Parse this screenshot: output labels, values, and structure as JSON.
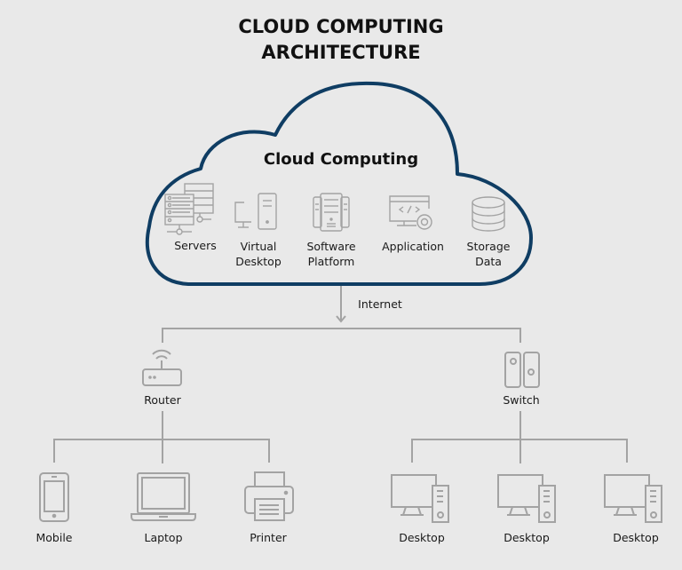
{
  "title": {
    "line1": "CLOUD COMPUTING",
    "line2": "ARCHITECTURE"
  },
  "colors": {
    "background": "#e9e9e9",
    "cloud_outline": "#0f3d63",
    "icon_stroke": "#a3a3a3",
    "connector": "#a3a3a3",
    "text": "#111111"
  },
  "cloud": {
    "title": "Cloud Computing",
    "services": [
      {
        "icon": "servers-icon",
        "line1": "Servers",
        "line2": ""
      },
      {
        "icon": "virtual-desktop-icon",
        "line1": "Virtual",
        "line2": "Desktop"
      },
      {
        "icon": "software-platform-icon",
        "line1": "Software",
        "line2": "Platform"
      },
      {
        "icon": "application-icon",
        "line1": "Application",
        "line2": ""
      },
      {
        "icon": "storage-data-icon",
        "line1": "Storage",
        "line2": "Data"
      }
    ]
  },
  "connection": {
    "label": "Internet",
    "arrow_icon": "arrow-down-icon"
  },
  "network": {
    "router": {
      "label": "Router",
      "icon": "router-icon",
      "devices": [
        {
          "label": "Mobile",
          "icon": "mobile-icon"
        },
        {
          "label": "Laptop",
          "icon": "laptop-icon"
        },
        {
          "label": "Printer",
          "icon": "printer-icon"
        }
      ]
    },
    "switch": {
      "label": "Switch",
      "icon": "switch-icon",
      "devices": [
        {
          "label": "Desktop",
          "icon": "desktop-icon"
        },
        {
          "label": "Desktop",
          "icon": "desktop-icon"
        },
        {
          "label": "Desktop",
          "icon": "desktop-icon"
        }
      ]
    }
  }
}
